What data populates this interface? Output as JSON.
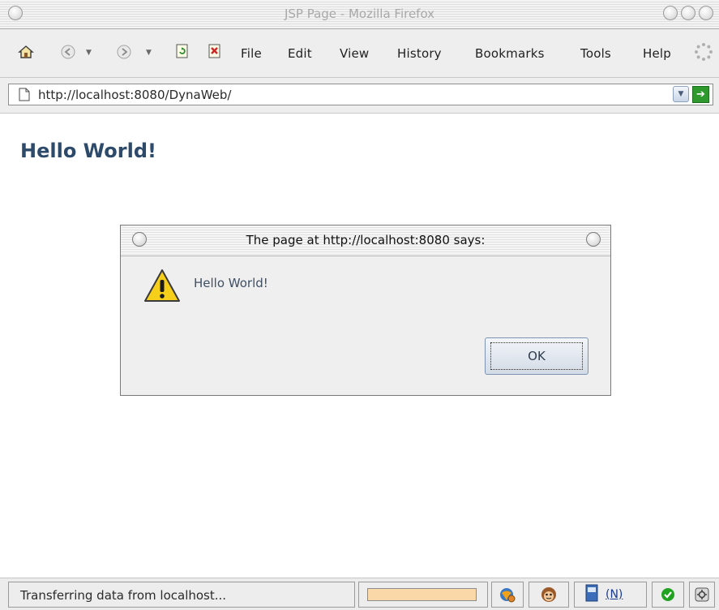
{
  "window": {
    "title": "JSP Page - Mozilla Firefox"
  },
  "menu": {
    "items": [
      {
        "label": "File"
      },
      {
        "label": "Edit"
      },
      {
        "label": "View"
      },
      {
        "label": "History"
      },
      {
        "label": "Bookmarks"
      },
      {
        "label": "Tools"
      },
      {
        "label": "Help"
      }
    ]
  },
  "toolbar": {
    "icons": [
      "home-icon",
      "back-icon",
      "back-dropdown-icon",
      "forward-icon",
      "forward-dropdown-icon",
      "reload-icon",
      "stop-icon",
      "throbber-icon"
    ]
  },
  "address": {
    "url": "http://localhost:8080/DynaWeb/",
    "page_icon": "page-icon",
    "go_icon": "go-arrow-icon"
  },
  "page": {
    "heading": "Hello World!"
  },
  "dialog": {
    "title": "The page at http://localhost:8080 says:",
    "message": "Hello World!",
    "ok_label": "OK",
    "icon": "warning-icon"
  },
  "status": {
    "text": "Transferring data from localhost...",
    "progress": 1.0,
    "link_label": "(N)",
    "icons": [
      "security-icon",
      "greasemonkey-icon",
      "notebook-icon",
      "check-icon",
      "extension-icon"
    ]
  },
  "colors": {
    "heading": "#2d4a6b",
    "progress_fill": "#fbd8a8",
    "go_button": "#2e9a2e"
  }
}
